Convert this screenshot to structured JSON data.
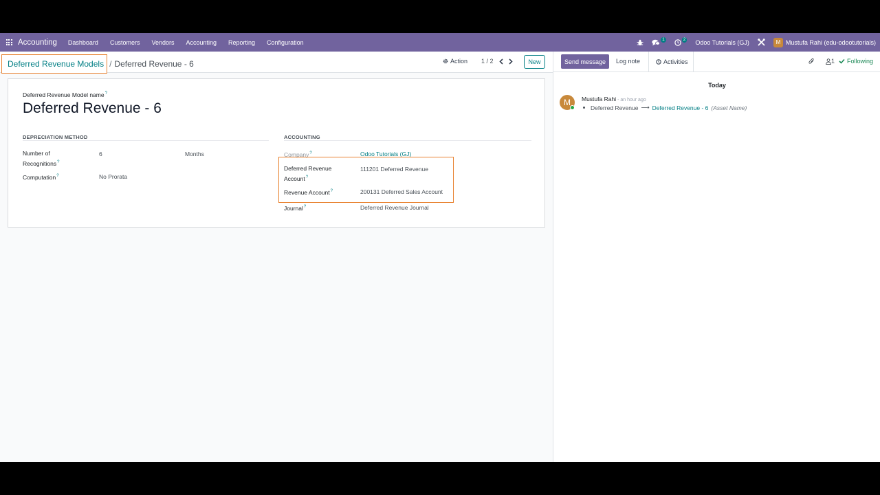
{
  "navbar": {
    "brand": "Accounting",
    "menu": [
      "Dashboard",
      "Customers",
      "Vendors",
      "Accounting",
      "Reporting",
      "Configuration"
    ],
    "messages_badge": "1",
    "activities_badge": "2",
    "company": "Odoo Tutorials (GJ)",
    "user_initial": "M",
    "user": "Mustufa Rahi (edu-odootutorials)"
  },
  "control": {
    "breadcrumb_parent": "Deferred Revenue Models",
    "breadcrumb_sep": "/",
    "breadcrumb_current": "Deferred Revenue - 6",
    "action_label": "Action",
    "pager": "1 / 2",
    "new_label": "New"
  },
  "form": {
    "name_label": "Deferred Revenue Model name",
    "name_value": "Deferred Revenue - 6",
    "depreciation": {
      "title": "DEPRECIATION METHOD",
      "recognitions_label_1": "Number of",
      "recognitions_label_2": "Recognitions",
      "recognitions_value": "6",
      "period_unit": "Months",
      "computation_label": "Computation",
      "computation_value": "No Prorata"
    },
    "accounting": {
      "title": "ACCOUNTING",
      "company_label": "Company",
      "company_value": "Odoo Tutorials (GJ)",
      "deferred_label_1": "Deferred Revenue",
      "deferred_label_2": "Account",
      "deferred_value": "111201 Deferred Revenue",
      "revenue_label": "Revenue Account",
      "revenue_value": "200131 Deferred Sales Account",
      "journal_label": "Journal",
      "journal_value": "Deferred Revenue Journal"
    },
    "help_mark": "?"
  },
  "chatter": {
    "send_message": "Send message",
    "log_note": "Log note",
    "activities": "Activities",
    "followers_count": "1",
    "following": "Following",
    "date_separator": "Today",
    "message": {
      "avatar_initial": "M",
      "author": "Mustufa Rahi",
      "time": "- an hour ago",
      "old_value": "Deferred Revenue",
      "arrow": "⟶",
      "new_value": "Deferred Revenue - 6",
      "field": "(Asset Name)"
    }
  },
  "colors": {
    "navbar": "#71639e",
    "link": "#017e84",
    "highlight": "#e8812f",
    "following": "#198754"
  }
}
